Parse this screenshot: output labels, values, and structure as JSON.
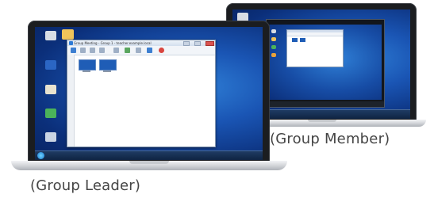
{
  "captions": {
    "leader": "(Group Leader)",
    "member": "(Group Member)"
  },
  "leader_laptop": {
    "window_title": "Group Meeting - Group 1 - teacher.example.local",
    "toolbar_icons": [
      "monitor-icon",
      "search-icon",
      "refresh-icon",
      "settings-icon",
      "lock-icon",
      "share-icon",
      "chat-icon",
      "link-icon",
      "stop-icon"
    ],
    "desktop_icons": [
      "recycle-bin-icon",
      "folder-icon",
      "word-icon",
      "network-icon",
      "app-icon",
      "tool-icon"
    ],
    "thumbnails": [
      {
        "label": ""
      },
      {
        "label": ""
      }
    ]
  },
  "member_laptop": {
    "desktop_icons": [
      "recycle-bin-icon",
      "folder-icon",
      "word-icon",
      "network-icon",
      "app-icon",
      "tool-icon"
    ]
  },
  "colors": {
    "desktop_blue": "#1a55b4",
    "laptop_bezel": "#1b1d20",
    "caption_text": "#454545"
  }
}
